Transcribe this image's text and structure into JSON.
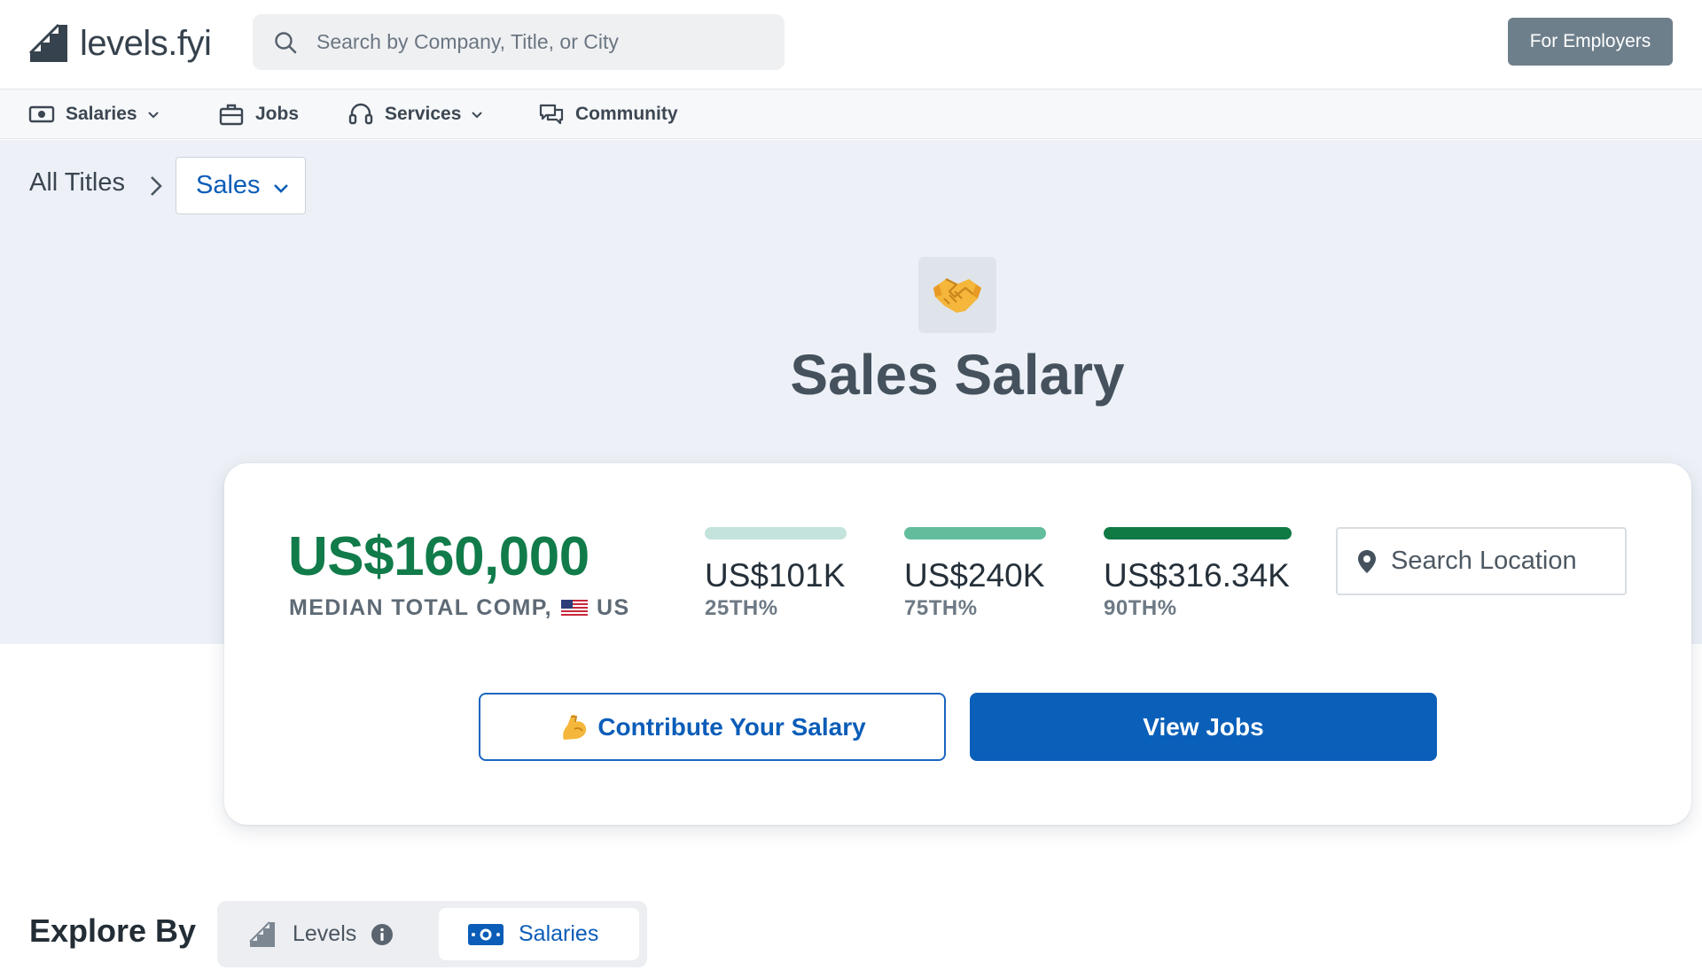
{
  "header": {
    "logo_text": "levels.fyi",
    "search_placeholder": "Search by Company, Title, or City",
    "employers_label": "For Employers"
  },
  "nav": {
    "items": [
      {
        "label": "Salaries",
        "icon": "money-icon",
        "dropdown": true
      },
      {
        "label": "Jobs",
        "icon": "briefcase-icon",
        "dropdown": false
      },
      {
        "label": "Services",
        "icon": "headset-icon",
        "dropdown": true
      },
      {
        "label": "Community",
        "icon": "chat-icon",
        "dropdown": false
      }
    ]
  },
  "breadcrumb": {
    "root": "All Titles",
    "current": "Sales"
  },
  "page": {
    "title": "Sales Salary",
    "emoji_icon": "handshake-icon"
  },
  "summary": {
    "median_value": "US$160,000",
    "median_label": "MEDIAN TOTAL COMP,",
    "country": "US",
    "percentiles": [
      {
        "value": "US$101K",
        "label": "25TH%",
        "color": "#c3e3dc"
      },
      {
        "value": "US$240K",
        "label": "75TH%",
        "color": "#63bd9c"
      },
      {
        "value": "US$316.34K",
        "label": "90TH%",
        "color": "#0f7a44"
      }
    ],
    "location_placeholder": "Search Location",
    "contribute_label": "Contribute Your Salary",
    "view_jobs_label": "View Jobs"
  },
  "explore": {
    "label": "Explore By",
    "options": [
      {
        "label": "Levels",
        "selected": false
      },
      {
        "label": "Salaries",
        "selected": true
      }
    ]
  },
  "colors": {
    "brand_blue": "#0a5fb9",
    "money_green": "#117b4a",
    "hero_bg": "#edf1f7"
  }
}
